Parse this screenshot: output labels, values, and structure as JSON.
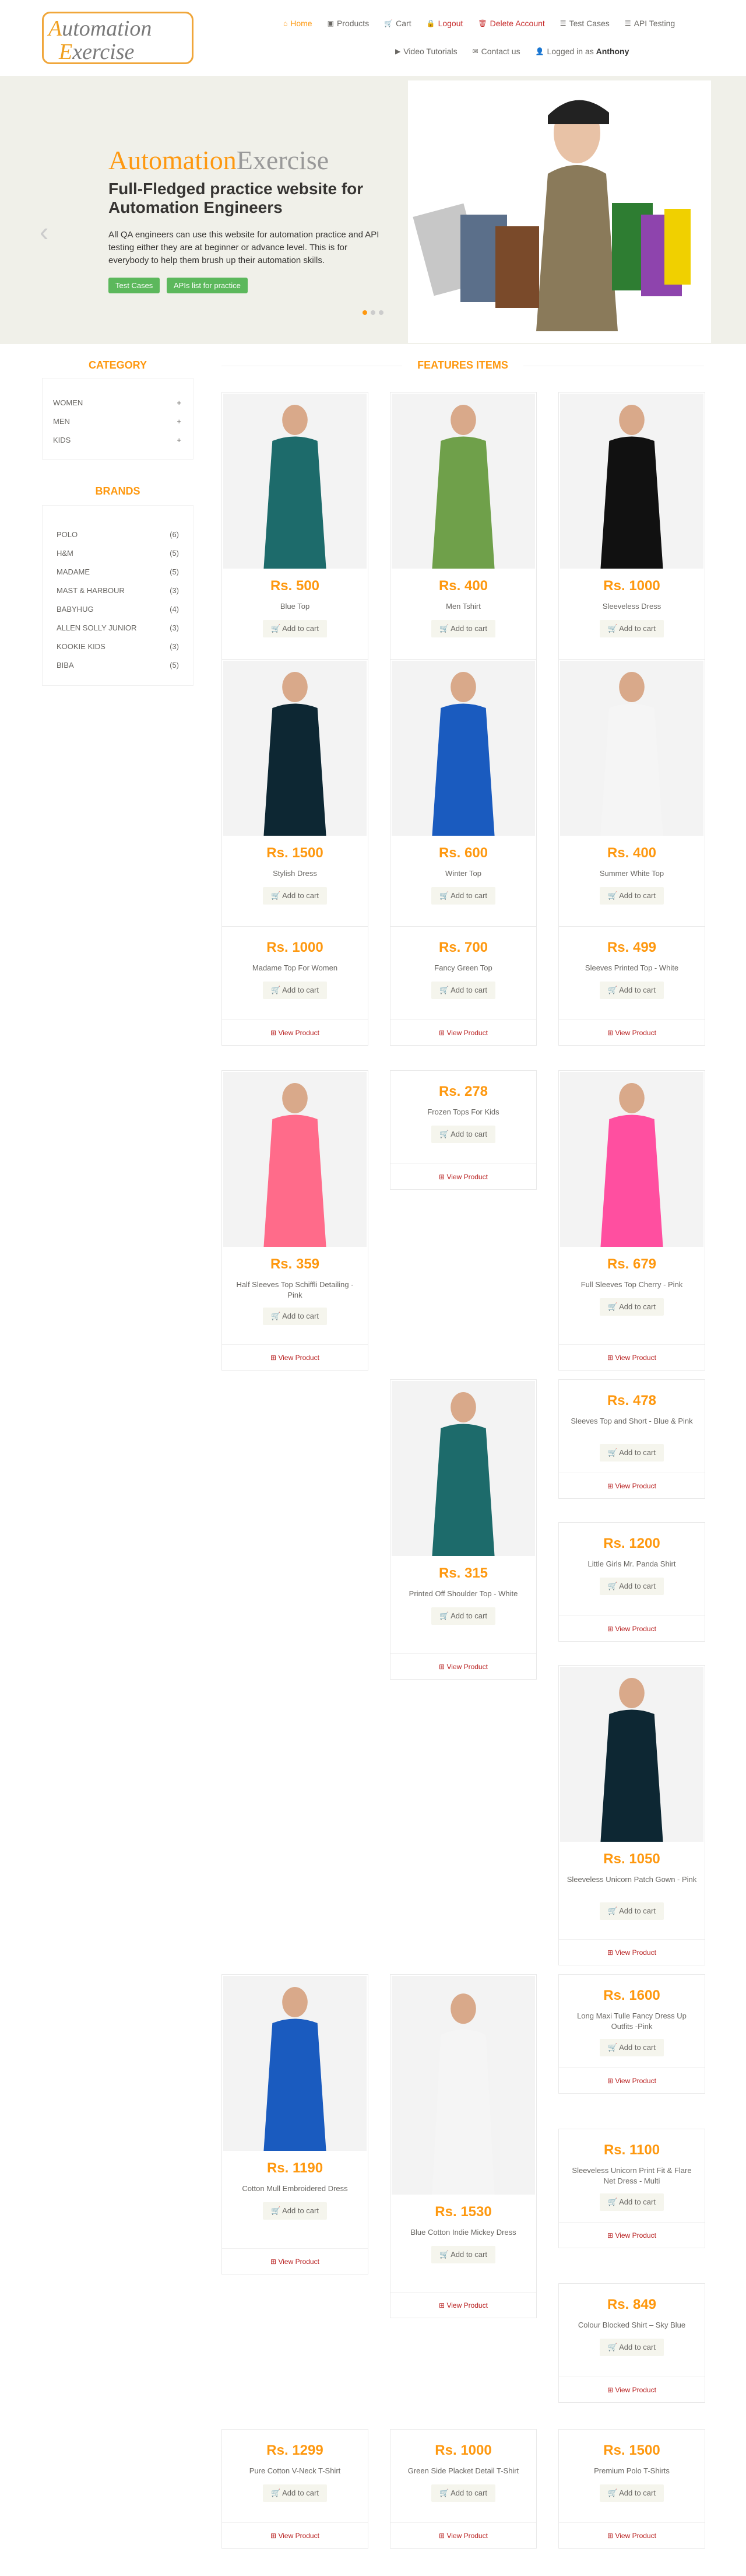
{
  "logo": {
    "line1": "utomation",
    "line1_cap": "A",
    "line2": "xercise",
    "line2_cap": "E"
  },
  "nav": [
    {
      "label": "Home",
      "icon": "home-icon",
      "glyph": "⌂"
    },
    {
      "label": "Products",
      "icon": "products-icon",
      "glyph": "▣"
    },
    {
      "label": "Cart",
      "icon": "cart-icon",
      "glyph": "🛒"
    },
    {
      "label": "Logout",
      "icon": "lock-icon",
      "glyph": "🔒"
    },
    {
      "label": "Delete Account",
      "icon": "trash-icon",
      "glyph": "🗑"
    },
    {
      "label": "Test Cases",
      "icon": "list-icon",
      "glyph": "☰"
    },
    {
      "label": "API Testing",
      "icon": "list-icon",
      "glyph": "☰"
    },
    {
      "label": "Video Tutorials",
      "icon": "youtube-icon",
      "glyph": "▶"
    },
    {
      "label": "Contact us",
      "icon": "envelope-icon",
      "glyph": "✉"
    }
  ],
  "logged_in": {
    "prefix": "Logged in as ",
    "user": "Anthony",
    "glyph": "👤"
  },
  "hero": {
    "brand_a": "Automation",
    "brand_b": "Exercise",
    "subtitle": "Full-Fledged practice website for Automation Engineers",
    "text": "All QA engineers can use this website for automation practice and API testing either they are at beginner or advance level. This is for everybody to help them brush up their automation skills.",
    "btn1": "Test Cases",
    "btn2": "APIs list for practice",
    "prev": "‹",
    "next": "›"
  },
  "sidebar": {
    "category_title": "CATEGORY",
    "categories": [
      {
        "label": "WOMEN",
        "sign": "+"
      },
      {
        "label": "MEN",
        "sign": "+"
      },
      {
        "label": "KIDS",
        "sign": "+"
      }
    ],
    "brands_title": "BRANDS",
    "brands": [
      {
        "name": "POLO",
        "count": "(6)"
      },
      {
        "name": "H&M",
        "count": "(5)"
      },
      {
        "name": "MADAME",
        "count": "(5)"
      },
      {
        "name": "MAST & HARBOUR",
        "count": "(3)"
      },
      {
        "name": "BABYHUG",
        "count": "(4)"
      },
      {
        "name": "ALLEN SOLLY JUNIOR",
        "count": "(3)"
      },
      {
        "name": "KOOKIE KIDS",
        "count": "(3)"
      },
      {
        "name": "BIBA",
        "count": "(5)"
      }
    ]
  },
  "features_title": "FEATURES ITEMS",
  "add_label": "Add to cart",
  "view_label": "View Product",
  "products": [
    {
      "price": "Rs. 500",
      "name": "Blue Top"
    },
    {
      "price": "Rs. 400",
      "name": "Men Tshirt"
    },
    {
      "price": "Rs. 1000",
      "name": "Sleeveless Dress"
    },
    {
      "price": "Rs. 1500",
      "name": "Stylish Dress"
    },
    {
      "price": "Rs. 600",
      "name": "Winter Top"
    },
    {
      "price": "Rs. 400",
      "name": "Summer White Top"
    },
    {
      "price": "Rs. 1000",
      "name": "Madame Top For Women"
    },
    {
      "price": "Rs. 700",
      "name": "Fancy Green Top"
    },
    {
      "price": "Rs. 499",
      "name": "Sleeves Printed Top - White"
    },
    {
      "price": "Rs. 359",
      "name": "Half Sleeves Top Schiffli Detailing - Pink"
    },
    {
      "price": "Rs. 278",
      "name": "Frozen Tops For Kids"
    },
    {
      "price": "Rs. 679",
      "name": "Full Sleeves Top Cherry - Pink"
    },
    {
      "price": "Rs. 315",
      "name": "Printed Off Shoulder Top - White"
    },
    {
      "price": "Rs. 478",
      "name": "Sleeves Top and Short - Blue & Pink"
    },
    {
      "price": "Rs. 1200",
      "name": "Little Girls Mr. Panda Shirt"
    },
    {
      "price": "Rs. 1050",
      "name": "Sleeveless Unicorn Patch Gown - Pink"
    },
    {
      "price": "Rs. 1190",
      "name": "Cotton Mull Embroidered Dress"
    },
    {
      "price": "Rs. 1530",
      "name": "Blue Cotton Indie Mickey Dress"
    },
    {
      "price": "Rs. 1600",
      "name": "Long Maxi Tulle Fancy Dress Up Outfits -Pink"
    },
    {
      "price": "Rs. 1100",
      "name": "Sleeveless Unicorn Print Fit & Flare Net Dress - Multi"
    },
    {
      "price": "Rs. 849",
      "name": "Colour Blocked Shirt – Sky Blue"
    },
    {
      "price": "Rs. 1299",
      "name": "Pure Cotton V-Neck T-Shirt"
    },
    {
      "price": "Rs. 1000",
      "name": "Green Side Placket Detail T-Shirt"
    },
    {
      "price": "Rs. 1500",
      "name": "Premium Polo T-Shirts"
    }
  ]
}
